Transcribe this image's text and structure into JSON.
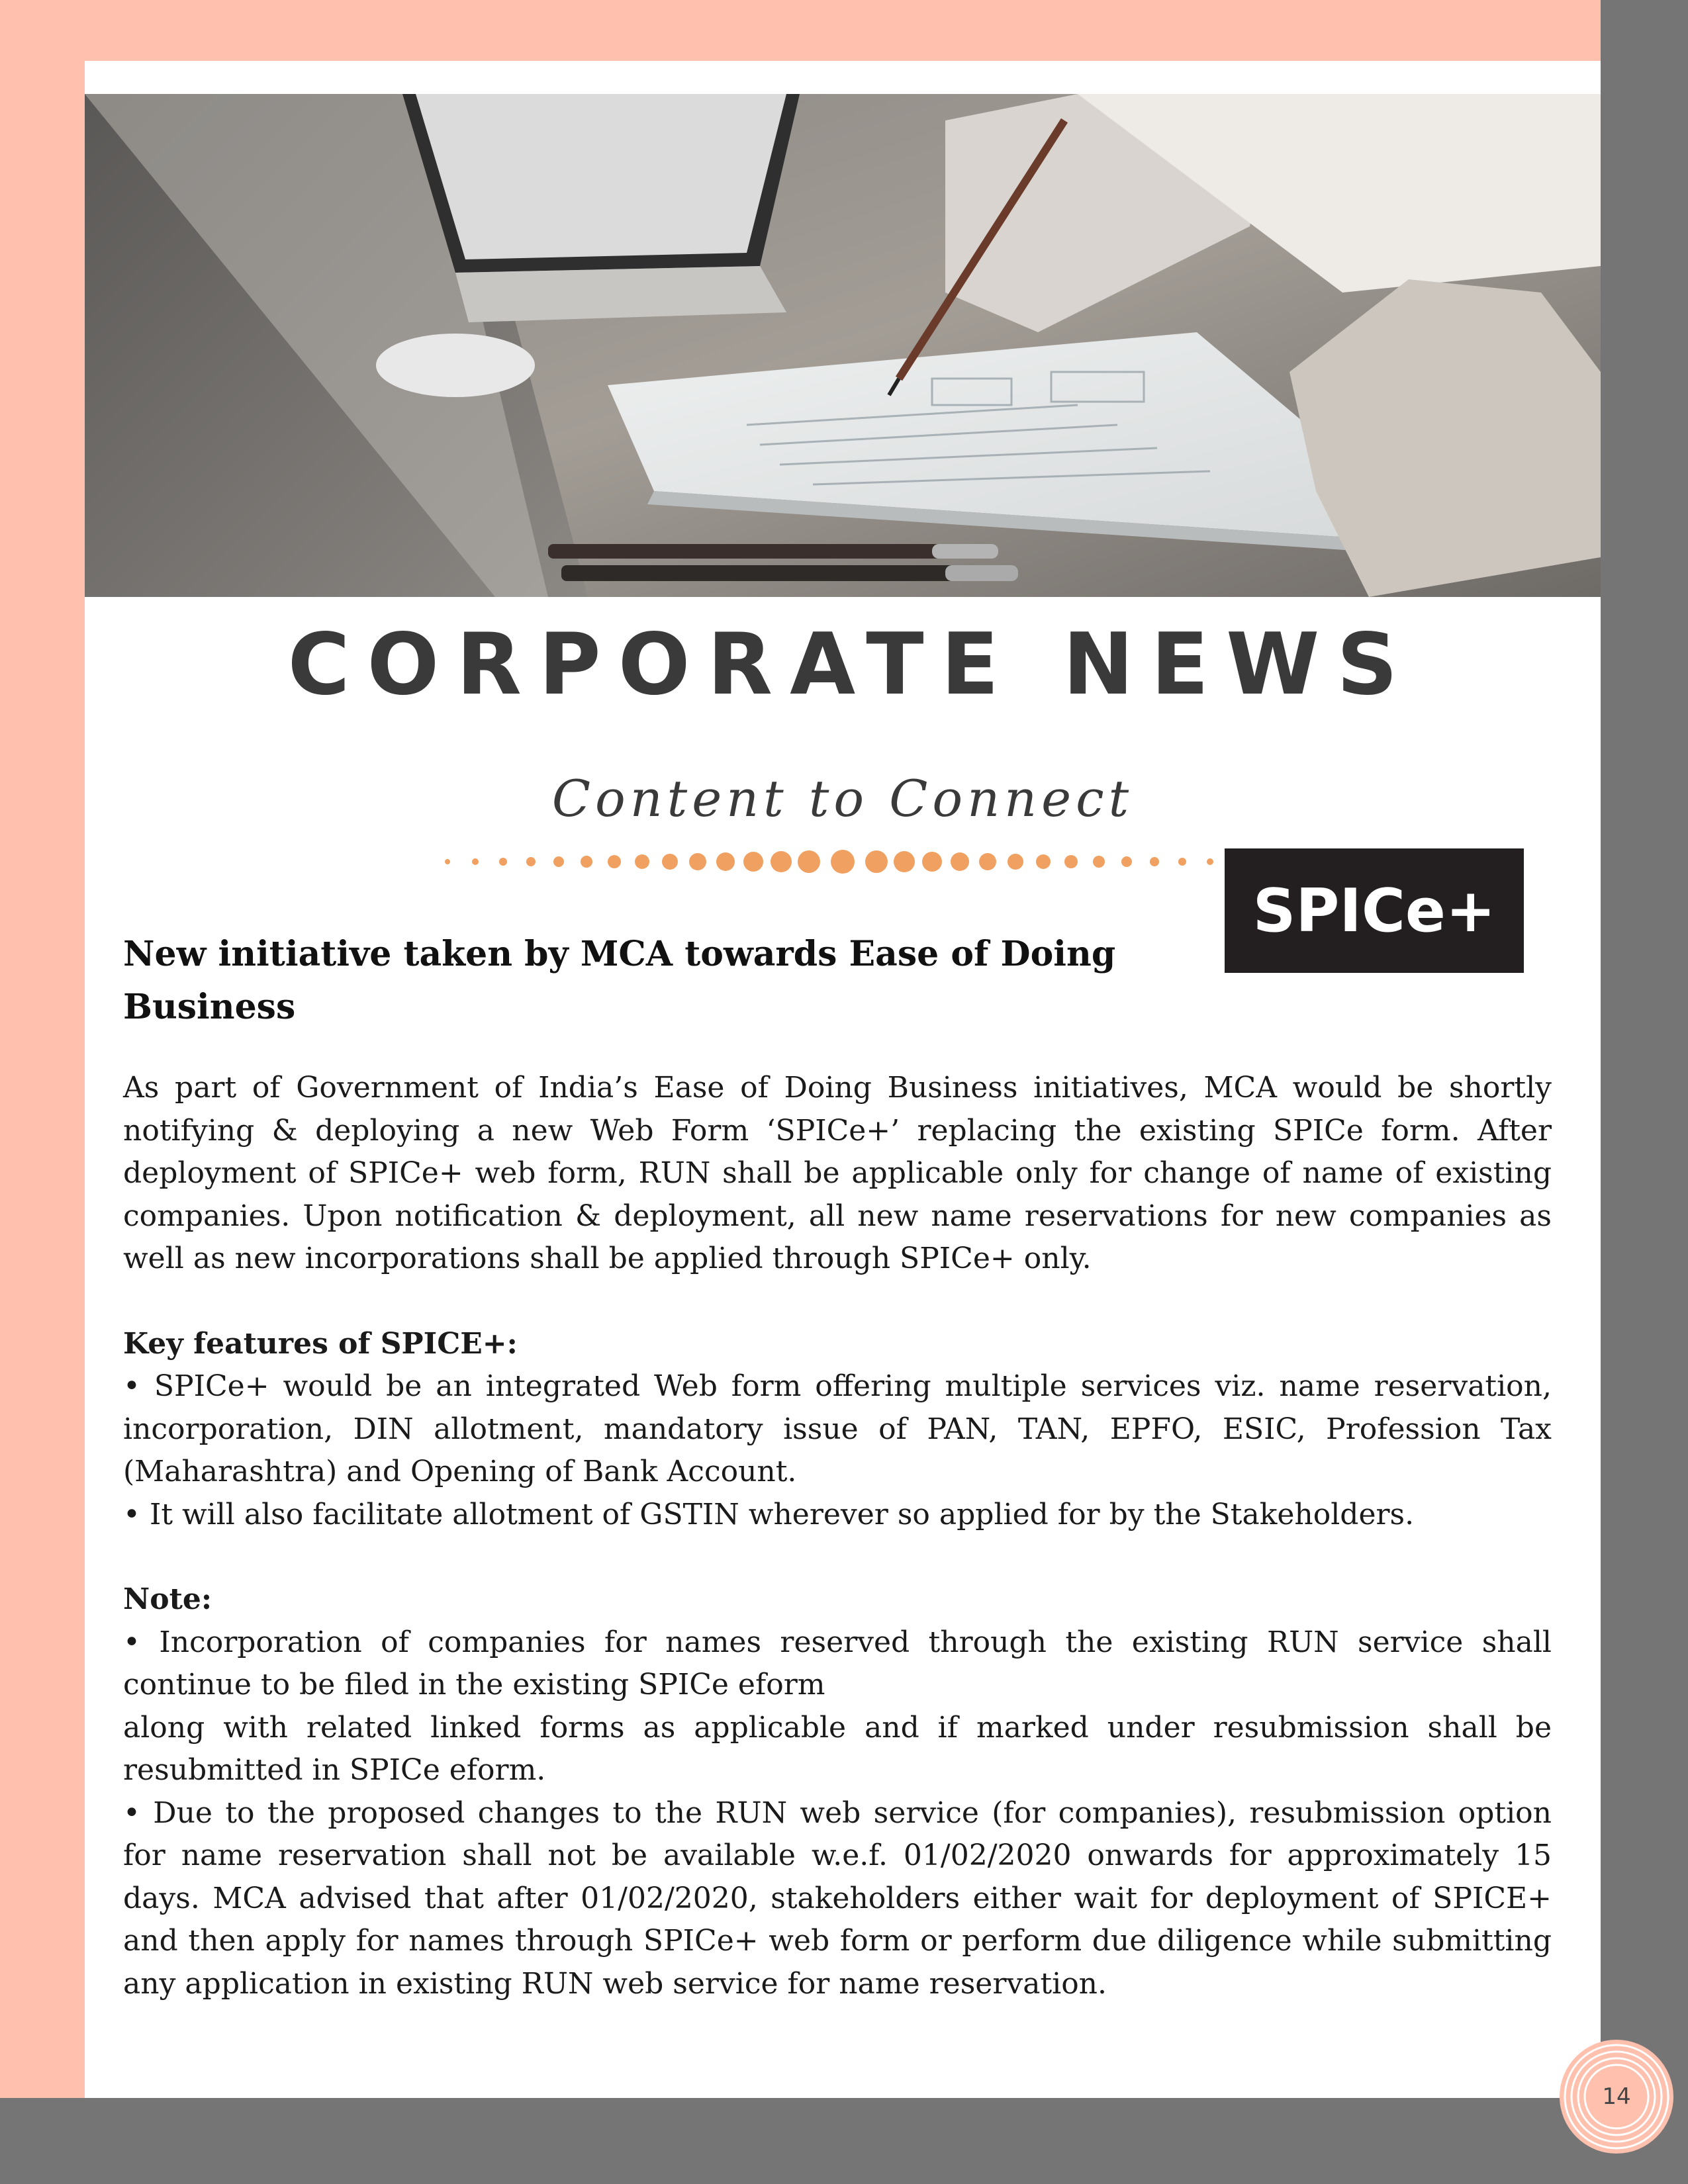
{
  "header": {
    "title": "CORPORATE NEWS",
    "subtitle": "Content to Connect"
  },
  "article": {
    "headline": "New initiative taken by MCA towards Ease of Doing Business",
    "badge": "SPICe+",
    "intro": "As part of Government of India’s Ease of Doing Business initiatives, MCA would be shortly notifying & deploying a new Web Form ‘SPICe+’ replacing the existing SPICe form. After deployment of SPICe+ web form, RUN shall be applicable only for change of name of existing companies. Upon notification & deployment, all new name reservations for new companies as well as new incorporations shall be applied through SPICe+ only.",
    "features_label": "Key features of SPICE+:",
    "features": [
      "• SPICe+ would be an integrated Web form offering multiple services viz. name reservation, incorporation, DIN allotment, mandatory issue of PAN, TAN, EPFO, ESIC, Profession Tax (Maharashtra) and Opening of Bank Account.",
      "• It will also facilitate allotment of GSTIN wherever so applied for by the Stakeholders."
    ],
    "note_label": "Note:",
    "notes": [
      "• Incorporation of companies for names reserved through the existing RUN service shall continue to be filed in the existing SPICe eform",
      "along with related linked forms as applicable and if marked under resubmission shall be resubmitted in SPICe eform.",
      "• Due to the proposed changes to the RUN web service (for companies), resubmission option for name reservation shall not be available w.e.f. 01/02/2020 onwards for approximately 15 days. MCA advised that after 01/02/2020, stakeholders either wait for deployment of SPICE+ and then apply for names through SPICe+ web form or perform due diligence while submitting any application in existing RUN web service for name reservation."
    ]
  },
  "footer": {
    "page_number": "14"
  },
  "colors": {
    "peach": "#ffc0ae",
    "gray": "#757575",
    "dot_accent": "#f0a060",
    "badge_bg": "#231f20",
    "title_text": "#3a3a3a"
  }
}
